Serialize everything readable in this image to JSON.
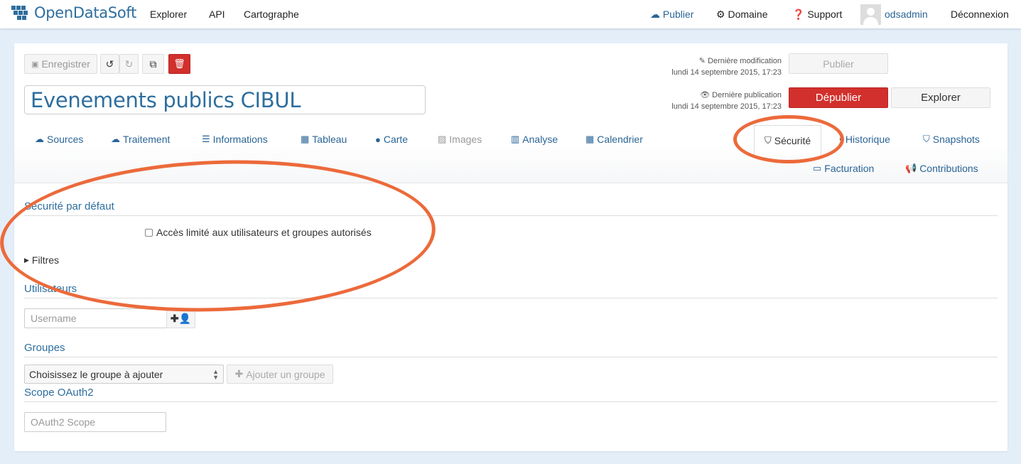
{
  "app": {
    "logo": "OpenDataSoft"
  },
  "topnav": {
    "explorer": "Explorer",
    "api": "API",
    "cartographe": "Cartographe",
    "publier": "Publier",
    "domaine": "Domaine",
    "support": "Support",
    "user": "odsadmin",
    "logout": "Déconnexion"
  },
  "toolbar": {
    "save_label": "Enregistrer"
  },
  "dataset": {
    "title": "Evenements publics CIBUL"
  },
  "meta": {
    "last_modified_label": "Dernière modification",
    "last_modified_date": "lundi 14 septembre 2015, 17:23",
    "last_published_label": "Dernière publication",
    "last_published_date": "lundi 14 septembre 2015, 17:23"
  },
  "actions": {
    "publish": "Publier",
    "unpublish": "Dépublier",
    "explore": "Explorer"
  },
  "tabs": [
    {
      "label": "Sources",
      "icon": "cloud-upload-icon"
    },
    {
      "label": "Traitement",
      "icon": "cloud-upload-icon"
    },
    {
      "label": "Informations",
      "icon": "list-icon"
    },
    {
      "label": "Tableau",
      "icon": "table-icon"
    },
    {
      "label": "Carte",
      "icon": "globe-icon"
    },
    {
      "label": "Images",
      "icon": "image-icon"
    },
    {
      "label": "Analyse",
      "icon": "bar-chart-icon"
    },
    {
      "label": "Calendrier",
      "icon": "calendar-icon"
    },
    {
      "label": "Sécurité",
      "icon": "shield-icon"
    },
    {
      "label": "Historique",
      "icon": "history-icon"
    },
    {
      "label": "Snapshots",
      "icon": "shield-icon"
    },
    {
      "label": "Facturation",
      "icon": "money-icon"
    },
    {
      "label": "Contributions",
      "icon": "bullhorn-icon"
    }
  ],
  "security": {
    "default_title": "Sécurité par défaut",
    "restricted_label": "Accès limité aux utilisateurs et groupes autorisés",
    "filters_label": "Filtres",
    "users_title": "Utilisateurs",
    "username_placeholder": "Username",
    "groups_title": "Groupes",
    "group_select_value": "Choisissez le groupe à ajouter",
    "add_group_label": "Ajouter un groupe",
    "oauth_title": "Scope OAuth2",
    "oauth_placeholder": "OAuth2 Scope"
  },
  "colors": {
    "accent": "#2e6e9e",
    "danger": "#d2302c",
    "annotation": "#ec6a3b"
  }
}
